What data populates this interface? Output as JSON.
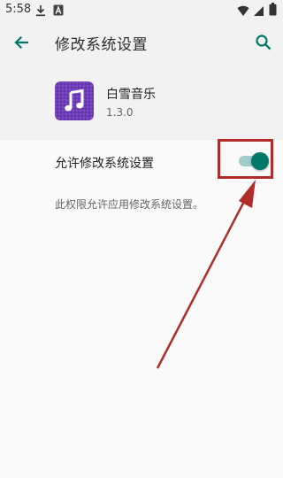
{
  "status_bar": {
    "time": "5:58"
  },
  "app_bar": {
    "title": "修改系统设置",
    "back_icon": "arrow-back-icon",
    "search_icon": "search-icon"
  },
  "app_info": {
    "name": "白雪音乐",
    "version": "1.3.0",
    "icon": "music-note-icon"
  },
  "setting": {
    "label": "允许修改系统设置",
    "toggle_on": true,
    "description": "此权限允许应用修改系统设置。"
  },
  "colors": {
    "accent": "#00796b",
    "toggle_track": "#a2ccc9",
    "annotation": "#b22b2b",
    "app_icon": "#6f3fb7"
  }
}
